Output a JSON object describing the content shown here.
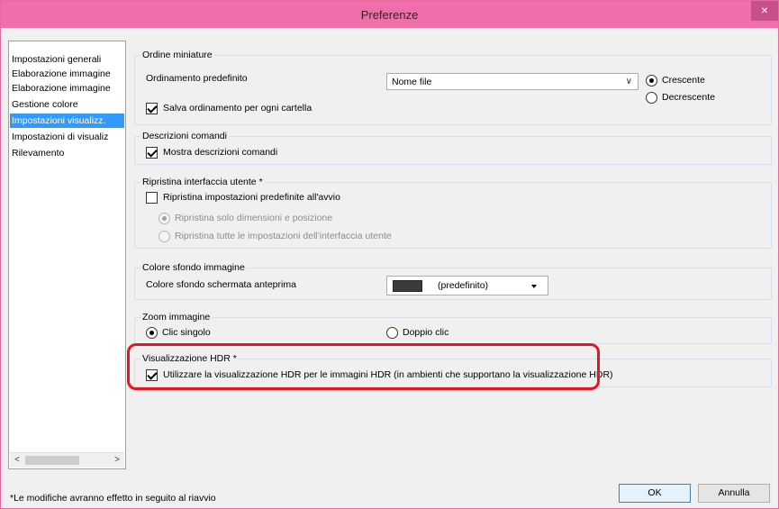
{
  "window": {
    "title": "Preferenze",
    "close_label": "×"
  },
  "sidebar": {
    "items": [
      {
        "label": "Impostazioni generali"
      },
      {
        "label": "Elaborazione immagine"
      },
      {
        "label": "Elaborazione immagine"
      },
      {
        "label": "Gestione colore"
      },
      {
        "label": "Impostazioni visualizz."
      },
      {
        "label": "Impostazioni di visualiz"
      },
      {
        "label": "Rilevamento"
      }
    ],
    "selected_index": 4,
    "scroll_left": "<",
    "scroll_right": ">"
  },
  "thumbnail_order": {
    "title": "Ordine miniature",
    "default_sort_label": "Ordinamento predefinito",
    "default_sort_value": "Nome file",
    "ascending_label": "Crescente",
    "descending_label": "Decrescente",
    "save_per_folder_label": "Salva ordinamento per ogni cartella"
  },
  "tooltips": {
    "title": "Descrizioni comandi",
    "show_label": "Mostra descrizioni comandi"
  },
  "reset_ui": {
    "title": "Ripristina interfaccia utente *",
    "reset_on_start_label": "Ripristina impostazioni predefinite all'avvio",
    "size_position_label": "Ripristina solo dimensioni e posizione",
    "all_settings_label": "Ripristina tutte le impostazioni dell'interfaccia utente"
  },
  "background_color": {
    "title": "Colore sfondo immagine",
    "preview_bg_label": "Colore sfondo schermata anteprima",
    "value": "(predefinito)",
    "swatch_color": "#3b3b3b"
  },
  "zoom": {
    "title": "Zoom immagine",
    "single_click_label": "Clic singolo",
    "double_click_label": "Doppio clic"
  },
  "hdr": {
    "title": "Visualizzazione HDR *",
    "use_hdr_label": "Utilizzare la visualizzazione HDR per le immagini HDR (in ambienti che supportano la visualizzazione HDR)",
    "highlight_color": "#e8141e"
  },
  "footer": {
    "note": "*Le modifiche avranno effetto in seguito al riavvio",
    "ok_label": "OK",
    "cancel_label": "Annulla"
  }
}
